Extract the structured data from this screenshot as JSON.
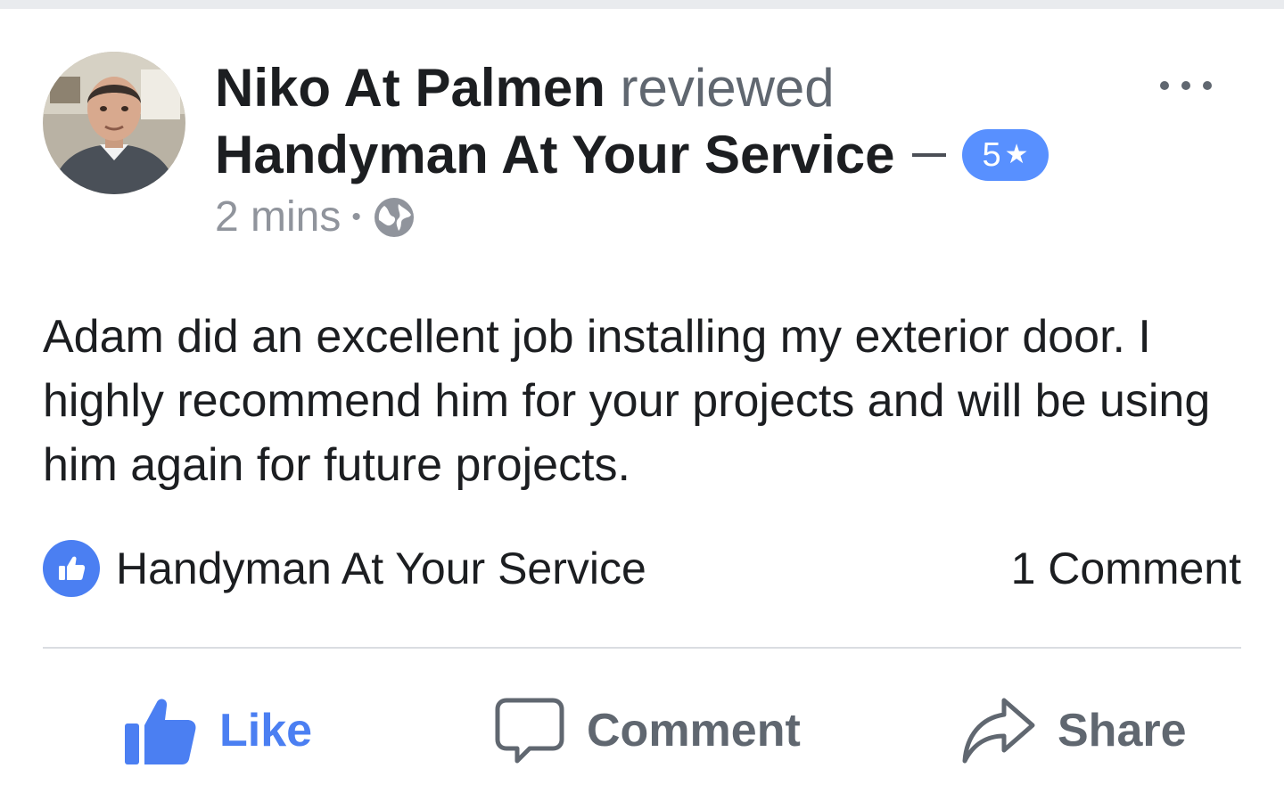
{
  "post": {
    "author": "Niko At Palmen",
    "action": "reviewed",
    "page_name": "Handyman At Your Service",
    "rating": "5",
    "rating_star": "★",
    "time": "2 mins",
    "separator": "•",
    "review_text": "Adam did an excellent job installing my exterior door. I highly recommend him for your projects and will be using him again for future projects."
  },
  "reactions": {
    "reactor": "Handyman At Your Service",
    "comments": "1 Comment"
  },
  "actions": {
    "like_label": "Like",
    "comment_label": "Comment",
    "share_label": "Share"
  },
  "icons": {
    "privacy": "globe-icon",
    "menu": "more-options-icon",
    "reaction": "thumbs-up-icon",
    "like": "thumbs-up-icon",
    "comment": "speech-bubble-icon",
    "share": "share-arrow-icon"
  },
  "colors": {
    "accent": "#4b7ff2",
    "rating_badge": "#5890ff",
    "text_primary": "#1c1e21",
    "text_secondary": "#606770",
    "text_meta": "#90949c",
    "divider": "#dadde1"
  }
}
